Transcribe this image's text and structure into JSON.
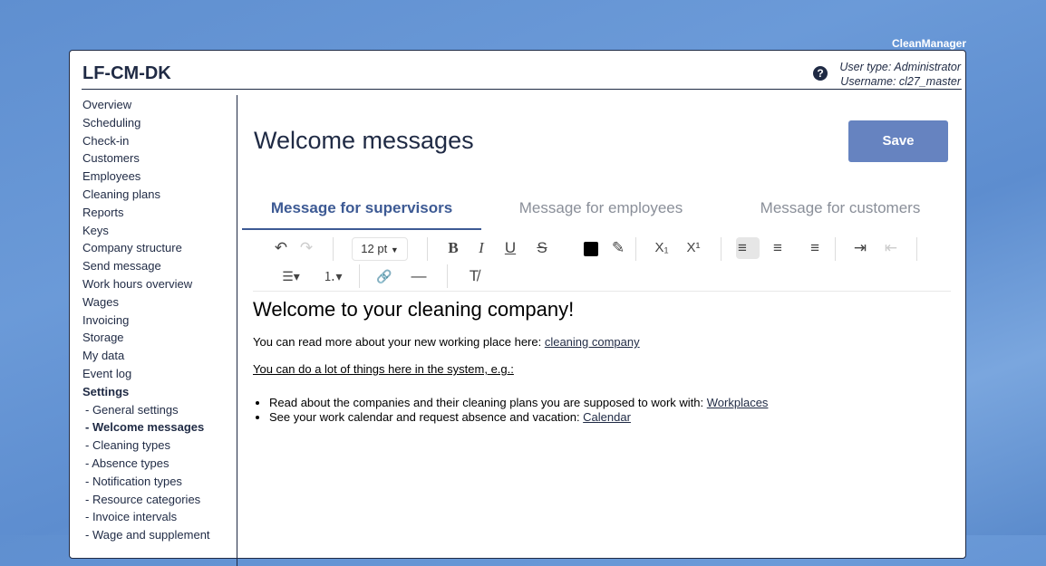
{
  "brand": "CleanManager",
  "app": {
    "title": "LF-CM-DK",
    "user_type": "User type: Administrator",
    "username": "Username: cl27_master",
    "help_glyph": "?"
  },
  "sidebar": {
    "items": [
      {
        "label": "Overview"
      },
      {
        "label": "Scheduling"
      },
      {
        "label": "Check-in"
      },
      {
        "label": "Customers"
      },
      {
        "label": "Employees"
      },
      {
        "label": "Cleaning plans"
      },
      {
        "label": "Reports"
      },
      {
        "label": "Keys"
      },
      {
        "label": "Company structure"
      },
      {
        "label": "Send message"
      },
      {
        "label": "Work hours overview"
      },
      {
        "label": "Wages"
      },
      {
        "label": "Invoicing"
      },
      {
        "label": "Storage"
      },
      {
        "label": "My data"
      },
      {
        "label": "Event log"
      },
      {
        "label": "Settings"
      }
    ],
    "sub_items": [
      {
        "label": "- General settings"
      },
      {
        "label": "- Welcome messages"
      },
      {
        "label": "- Cleaning types"
      },
      {
        "label": "- Absence types"
      },
      {
        "label": "- Notification types"
      },
      {
        "label": "- Resource categories"
      },
      {
        "label": "- Invoice intervals"
      },
      {
        "label": "- Wage and supplement"
      }
    ]
  },
  "page": {
    "title": "Welcome messages",
    "save_label": "Save"
  },
  "tabs": [
    {
      "label": "Message for supervisors",
      "active": true
    },
    {
      "label": "Message for employees",
      "active": false
    },
    {
      "label": "Message for customers",
      "active": false
    }
  ],
  "toolbar": {
    "font_size": "12 pt",
    "icons": {
      "undo": "↶",
      "redo": "↷",
      "bold": "B",
      "italic": "I",
      "underline": "U",
      "strikethrough": "S",
      "highlight": "✎",
      "subscript": "X₁",
      "superscript": "X¹",
      "align_left": "≡",
      "align_center": "≡",
      "align_right": "≡",
      "indent": "⇥",
      "outdent": "⇤",
      "bullet_list": "☰▾",
      "numbered_list": "⒈▾",
      "link": "🔗",
      "horizontal_rule": "—",
      "clear_format": "T̸"
    },
    "text_color": "#000000"
  },
  "editor": {
    "heading": "Welcome to your cleaning company!",
    "p1_text": "You can read more about your new working place here: ",
    "p1_link": "cleaning company",
    "p2_text": "You can do a lot of things here in the system, e.g.:",
    "list": [
      {
        "text": "Read about the companies and their cleaning plans you are supposed to work with: ",
        "link": "Workplaces"
      },
      {
        "text": "See your work calendar and request absence and vacation: ",
        "link": "Calendar"
      }
    ]
  },
  "colors": {
    "primary": "#1f2a44",
    "accent": "#3d5a94",
    "save_button": "#6683c0"
  }
}
